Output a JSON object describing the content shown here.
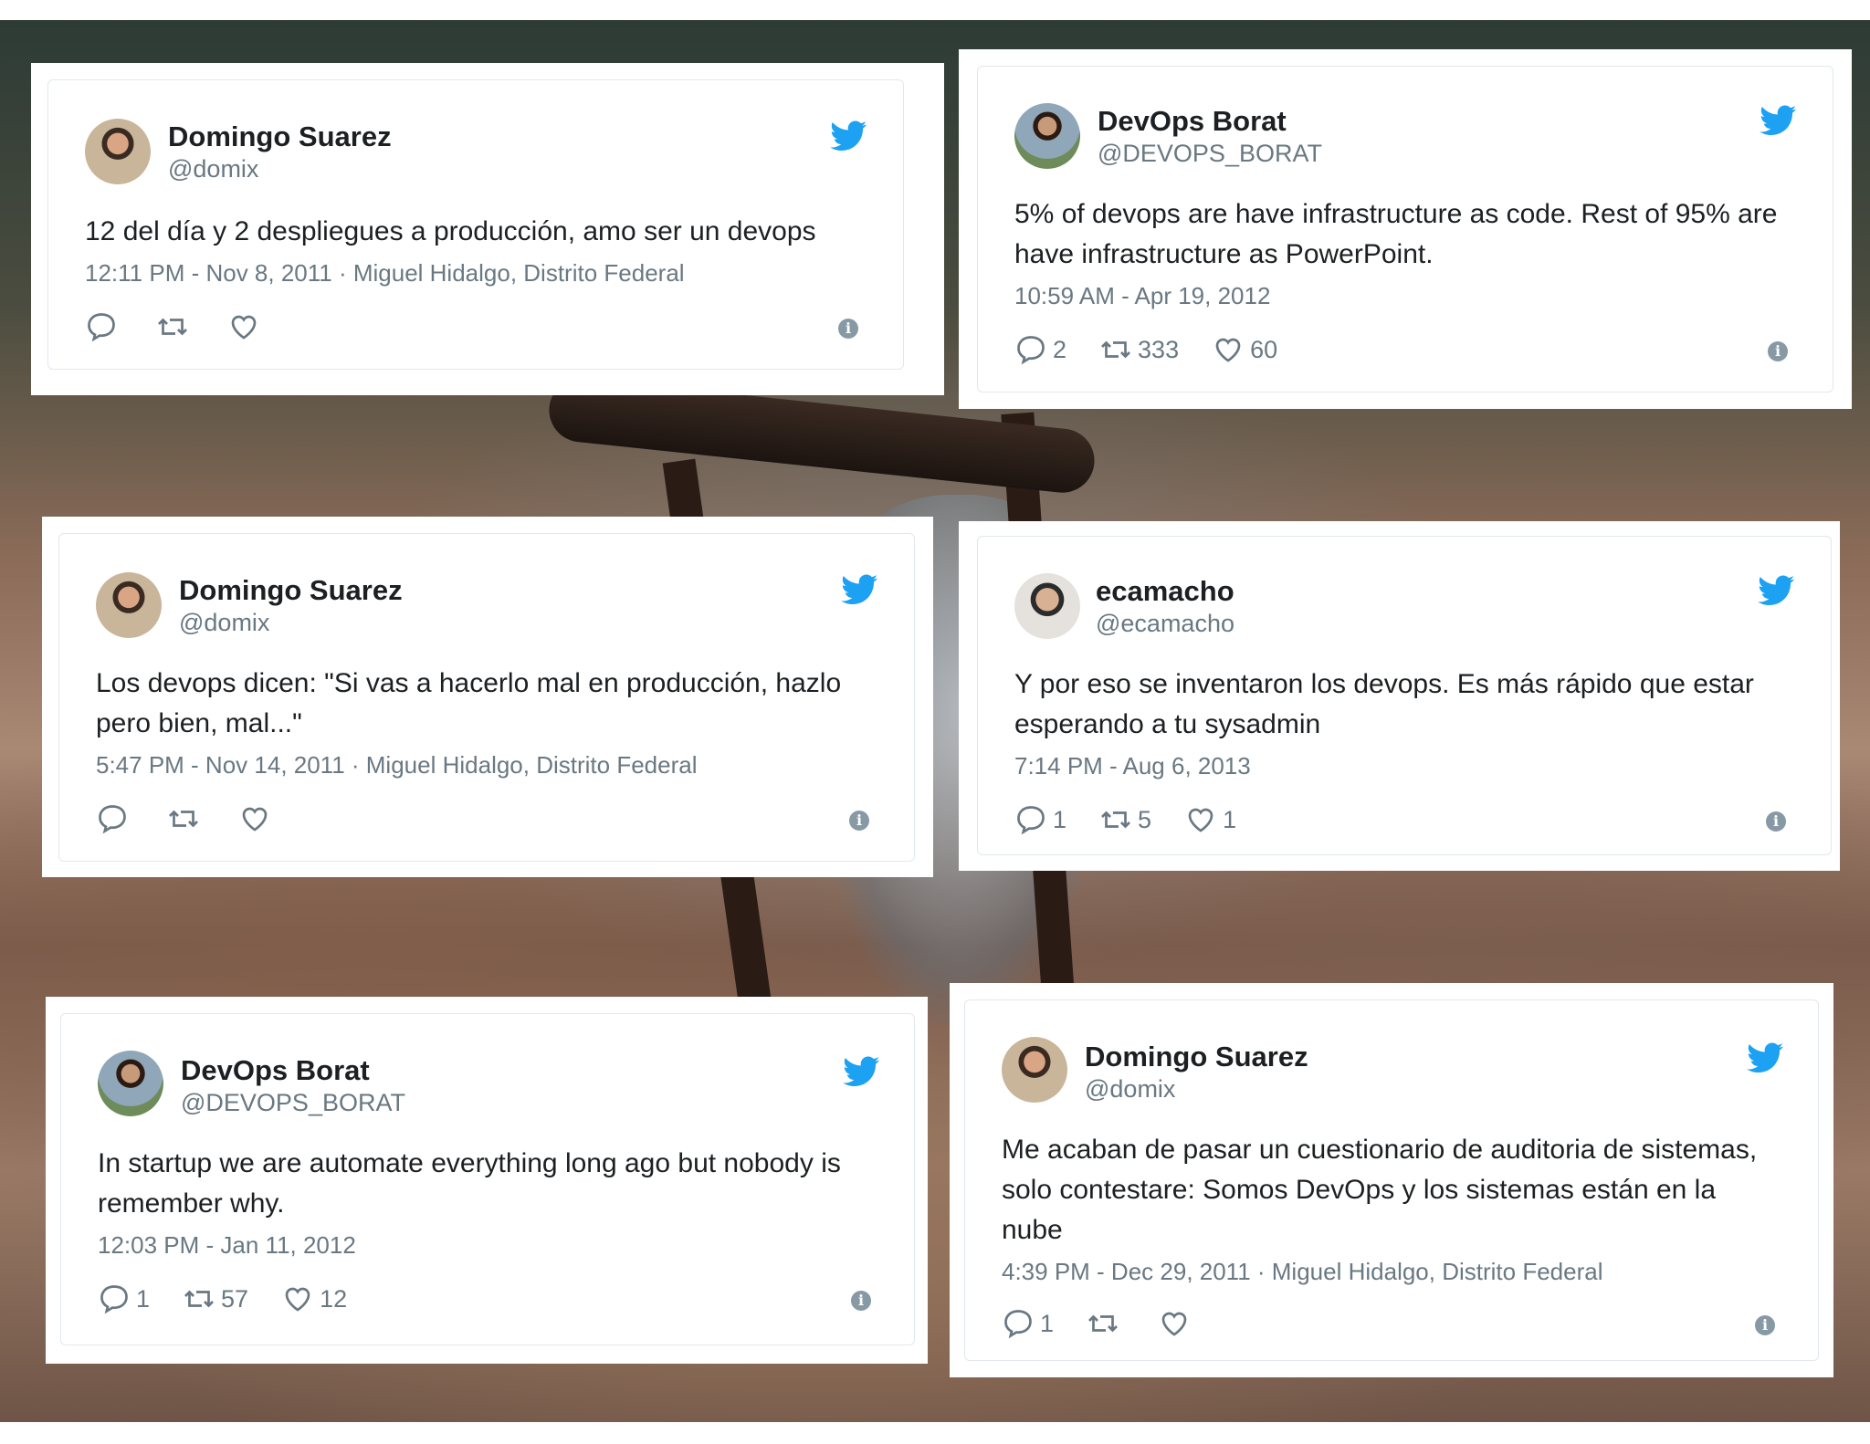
{
  "tweets": [
    {
      "name": "Domingo Suarez",
      "handle": "@domix",
      "text": "12 del día y 2 despliegues a producción, amo ser un devops",
      "meta": "12:11 PM - Nov 8, 2011 · Miguel Hidalgo, Distrito Federal",
      "replies": "",
      "retweets": "",
      "likes": "",
      "avatar": "domingo-avatar"
    },
    {
      "name": "DevOps Borat",
      "handle": "@DEVOPS_BORAT",
      "text": "5% of devops are have infrastructure as code. Rest of 95% are have infrastructure as PowerPoint.",
      "meta": "10:59 AM - Apr 19, 2012",
      "replies": "2",
      "retweets": "333",
      "likes": "60",
      "avatar": "borat-avatar"
    },
    {
      "name": "Domingo Suarez",
      "handle": "@domix",
      "text": "Los devops dicen: \"Si vas a hacerlo mal en producción, hazlo pero bien, mal...\"",
      "meta": "5:47 PM - Nov 14, 2011 · Miguel Hidalgo, Distrito Federal",
      "replies": "",
      "retweets": "",
      "likes": "",
      "avatar": "domingo-avatar"
    },
    {
      "name": "ecamacho",
      "handle": "@ecamacho",
      "text": "Y por eso se inventaron los devops. Es más rápido que estar esperando a tu sysadmin",
      "meta": "7:14 PM - Aug 6, 2013",
      "replies": "1",
      "retweets": "5",
      "likes": "1",
      "avatar": "ecamacho-avatar"
    },
    {
      "name": "DevOps Borat",
      "handle": "@DEVOPS_BORAT",
      "text": "In startup we are automate everything long ago but nobody is remember why.",
      "meta": "12:03 PM - Jan 11, 2012",
      "replies": "1",
      "retweets": "57",
      "likes": "12",
      "avatar": "borat-avatar"
    },
    {
      "name": "Domingo Suarez",
      "handle": "@domix",
      "text": "Me acaban de pasar un cuestionario de auditoria de sistemas, solo contestare: Somos DevOps y los sistemas están en la nube",
      "meta": "4:39 PM - Dec 29, 2011 · Miguel Hidalgo, Distrito Federal",
      "replies": "1",
      "retweets": "",
      "likes": "",
      "avatar": "domingo-avatar"
    }
  ],
  "colors": {
    "twitter_blue": "#1da1f2",
    "muted": "#697882",
    "text": "#1c2022",
    "border": "#e1e8ed"
  },
  "icons": {
    "bird": "twitter-bird-icon",
    "reply": "reply-icon",
    "retweet": "retweet-icon",
    "like": "heart-icon",
    "info": "info-icon"
  }
}
